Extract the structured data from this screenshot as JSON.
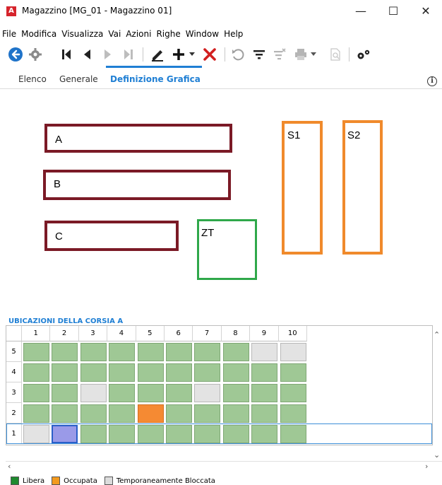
{
  "window": {
    "app_icon": "A",
    "title": "Magazzino [MG_01 - Magazzino 01]",
    "minimize_glyph": "—",
    "maximize_glyph": "☐",
    "close_glyph": "✕"
  },
  "menu": [
    "File",
    "Modifica",
    "Visualizza",
    "Vai",
    "Azioni",
    "Righe",
    "Window",
    "Help"
  ],
  "toolbar": {
    "icons": [
      "back-icon",
      "settings-icon",
      "first-record-icon",
      "previous-record-icon",
      "next-record-icon",
      "last-record-icon",
      "edit-icon",
      "add-icon",
      "dropdown-arrow-icon",
      "delete-icon",
      "undo-icon",
      "filter-icon",
      "remove-filter-icon",
      "print-icon",
      "print-dropdown-icon",
      "preview-icon",
      "options-icon"
    ]
  },
  "tabs": [
    {
      "label": "Elenco",
      "active": false
    },
    {
      "label": "Generale",
      "active": false
    },
    {
      "label": "Definizione Grafica",
      "active": true
    }
  ],
  "info_glyph": "i",
  "zones": [
    {
      "label": "A",
      "color": "#7b1a26"
    },
    {
      "label": "B",
      "color": "#7b1a26"
    },
    {
      "label": "C",
      "color": "#7b1a26"
    },
    {
      "label": "ZT",
      "color": "#2fa84a"
    },
    {
      "label": "S1",
      "color": "#f08a2c"
    },
    {
      "label": "S2",
      "color": "#f08a2c"
    }
  ],
  "grid": {
    "title": "UBICAZIONI DELLA CORSIA A",
    "columns": [
      "1",
      "2",
      "3",
      "4",
      "5",
      "6",
      "7",
      "8",
      "9",
      "10"
    ],
    "rows": [
      {
        "label": "5",
        "cells": [
          "libera",
          "libera",
          "libera",
          "libera",
          "libera",
          "libera",
          "libera",
          "libera",
          "bloccata",
          "bloccata"
        ]
      },
      {
        "label": "4",
        "cells": [
          "libera",
          "libera",
          "libera",
          "libera",
          "libera",
          "libera",
          "libera",
          "libera",
          "libera",
          "libera"
        ]
      },
      {
        "label": "3",
        "cells": [
          "libera",
          "libera",
          "bloccata",
          "libera",
          "libera",
          "libera",
          "bloccata",
          "libera",
          "libera",
          "libera"
        ]
      },
      {
        "label": "2",
        "cells": [
          "libera",
          "libera",
          "libera",
          "libera",
          "occupata",
          "libera",
          "libera",
          "libera",
          "libera",
          "libera"
        ]
      },
      {
        "label": "1",
        "cells": [
          "bloccata",
          "selected",
          "libera",
          "libera",
          "libera",
          "libera",
          "libera",
          "libera",
          "libera",
          "libera"
        ]
      }
    ]
  },
  "legend": [
    {
      "label": "Libera",
      "color": "#1e8a2e"
    },
    {
      "label": "Occupata",
      "color": "#f39a1e"
    },
    {
      "label": "Temporaneamente Bloccata",
      "color": "#dcdcdc"
    }
  ]
}
